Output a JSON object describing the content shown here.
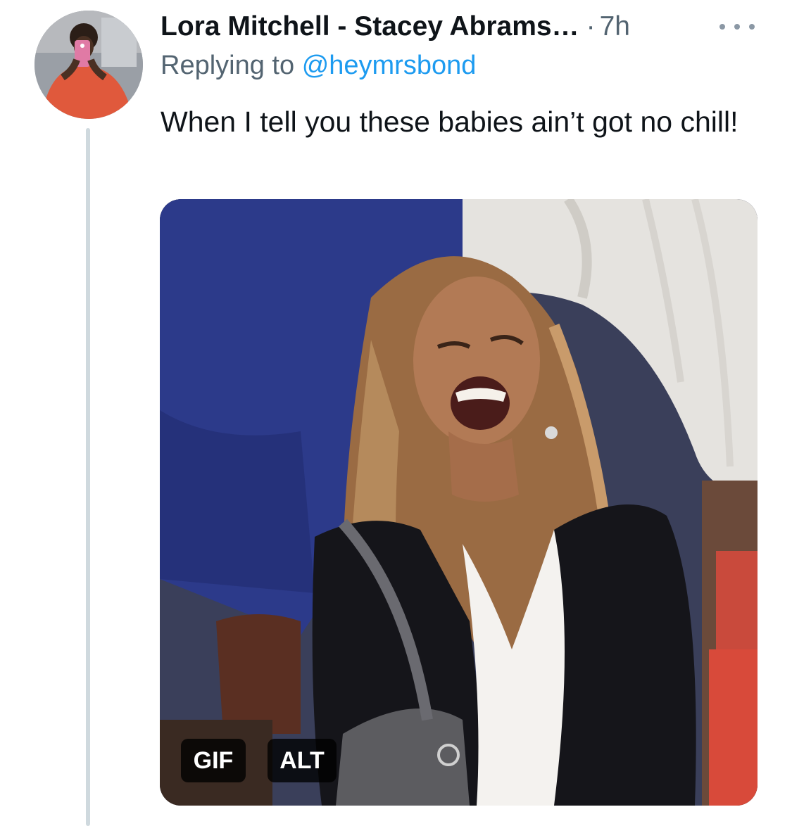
{
  "tweet": {
    "display_name": "Lora Mitchell - Stacey Abrams…",
    "separator": "·",
    "time": "7h",
    "replying_prefix": "Replying to",
    "replying_handle": "@heymrsbond",
    "text": "When I tell you these babies ain’t got no chill!",
    "media": {
      "gif_badge": "GIF",
      "alt_badge": "ALT"
    }
  },
  "icons": {
    "more": "more-horizontal-icon",
    "avatar": "user-avatar"
  },
  "colors": {
    "text_primary": "#0f1419",
    "text_secondary": "#536471",
    "link": "#1d9bf0",
    "thread_line": "#cfd9de"
  }
}
